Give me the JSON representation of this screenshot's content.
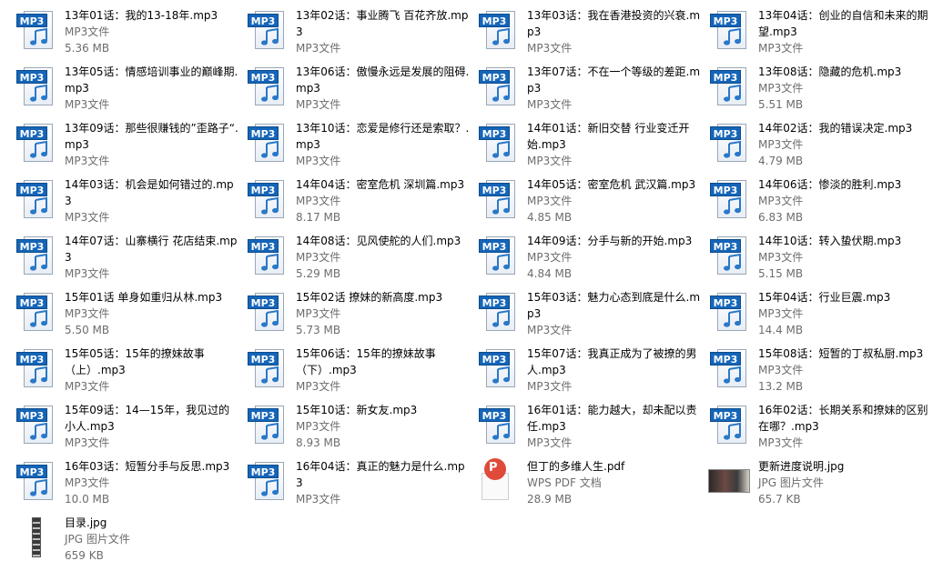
{
  "files": [
    {
      "name": "13年01话：我的13-18年.mp3",
      "type": "MP3文件",
      "size": "5.36 MB",
      "icon": "mp3-file-icon"
    },
    {
      "name": "13年02话：事业腾飞 百花齐放.mp3",
      "type": "MP3文件",
      "size": "",
      "icon": "mp3-file-icon"
    },
    {
      "name": "13年03话：我在香港投资的兴衰.mp3",
      "type": "MP3文件",
      "size": "",
      "icon": "mp3-file-icon"
    },
    {
      "name": "13年04话：创业的自信和未来的期望.mp3",
      "type": "MP3文件",
      "size": "",
      "icon": "mp3-file-icon"
    },
    {
      "name": "13年05话：情感培训事业的巅峰期.mp3",
      "type": "MP3文件",
      "size": "",
      "icon": "mp3-file-icon"
    },
    {
      "name": "13年06话：傲慢永远是发展的阻碍.mp3",
      "type": "MP3文件",
      "size": "",
      "icon": "mp3-file-icon"
    },
    {
      "name": "13年07话：不在一个等级的差距.mp3",
      "type": "MP3文件",
      "size": "",
      "icon": "mp3-file-icon"
    },
    {
      "name": "13年08话：隐藏的危机.mp3",
      "type": "MP3文件",
      "size": "5.51 MB",
      "icon": "mp3-file-icon"
    },
    {
      "name": "13年09话：那些很赚钱的”歪路子“.mp3",
      "type": "MP3文件",
      "size": "",
      "icon": "mp3-file-icon"
    },
    {
      "name": "13年10话：恋爱是修行还是索取？.mp3",
      "type": "MP3文件",
      "size": "",
      "icon": "mp3-file-icon"
    },
    {
      "name": "14年01话：新旧交替 行业变迁开始.mp3",
      "type": "MP3文件",
      "size": "",
      "icon": "mp3-file-icon"
    },
    {
      "name": "14年02话：我的错误决定.mp3",
      "type": "MP3文件",
      "size": "4.79 MB",
      "icon": "mp3-file-icon"
    },
    {
      "name": "14年03话：机会是如何错过的.mp3",
      "type": "MP3文件",
      "size": "",
      "icon": "mp3-file-icon"
    },
    {
      "name": "14年04话：密室危机 深圳篇.mp3",
      "type": "MP3文件",
      "size": "8.17 MB",
      "icon": "mp3-file-icon"
    },
    {
      "name": "14年05话：密室危机 武汉篇.mp3",
      "type": "MP3文件",
      "size": "4.85 MB",
      "icon": "mp3-file-icon"
    },
    {
      "name": "14年06话：惨淡的胜利.mp3",
      "type": "MP3文件",
      "size": "6.83 MB",
      "icon": "mp3-file-icon"
    },
    {
      "name": "14年07话：山寨横行 花店结束.mp3",
      "type": "MP3文件",
      "size": "",
      "icon": "mp3-file-icon"
    },
    {
      "name": "14年08话：见风使舵的人们.mp3",
      "type": "MP3文件",
      "size": "5.29 MB",
      "icon": "mp3-file-icon"
    },
    {
      "name": "14年09话：分手与新的开始.mp3",
      "type": "MP3文件",
      "size": "4.84 MB",
      "icon": "mp3-file-icon"
    },
    {
      "name": "14年10话：转入蛰伏期.mp3",
      "type": "MP3文件",
      "size": "5.15 MB",
      "icon": "mp3-file-icon"
    },
    {
      "name": "15年01话 单身如重归从林.mp3",
      "type": "MP3文件",
      "size": "5.50 MB",
      "icon": "mp3-file-icon"
    },
    {
      "name": "15年02话 撩妹的新高度.mp3",
      "type": "MP3文件",
      "size": "5.73 MB",
      "icon": "mp3-file-icon"
    },
    {
      "name": "15年03话：魅力心态到底是什么.mp3",
      "type": "MP3文件",
      "size": "",
      "icon": "mp3-file-icon"
    },
    {
      "name": "15年04话：行业巨震.mp3",
      "type": "MP3文件",
      "size": "14.4 MB",
      "icon": "mp3-file-icon"
    },
    {
      "name": "15年05话：15年的撩妹故事（上）.mp3",
      "type": "MP3文件",
      "size": "",
      "icon": "mp3-file-icon"
    },
    {
      "name": "15年06话：15年的撩妹故事（下）.mp3",
      "type": "MP3文件",
      "size": "",
      "icon": "mp3-file-icon"
    },
    {
      "name": "15年07话：我真正成为了被撩的男人.mp3",
      "type": "MP3文件",
      "size": "",
      "icon": "mp3-file-icon"
    },
    {
      "name": "15年08话：短暂的丁叔私厨.mp3",
      "type": "MP3文件",
      "size": "13.2 MB",
      "icon": "mp3-file-icon"
    },
    {
      "name": "15年09话：14—15年，我见过的小人.mp3",
      "type": "MP3文件",
      "size": "",
      "icon": "mp3-file-icon"
    },
    {
      "name": "15年10话：新女友.mp3",
      "type": "MP3文件",
      "size": "8.93 MB",
      "icon": "mp3-file-icon"
    },
    {
      "name": "16年01话：能力越大，却未配以责任.mp3",
      "type": "MP3文件",
      "size": "",
      "icon": "mp3-file-icon"
    },
    {
      "name": "16年02话：长期关系和撩妹的区别在哪？.mp3",
      "type": "MP3文件",
      "size": "",
      "icon": "mp3-file-icon"
    },
    {
      "name": "16年03话：短暂分手与反思.mp3",
      "type": "MP3文件",
      "size": "10.0 MB",
      "icon": "mp3-file-icon"
    },
    {
      "name": "16年04话：真正的魅力是什么.mp3",
      "type": "MP3文件",
      "size": "",
      "icon": "mp3-file-icon"
    },
    {
      "name": "但丁的多维人生.pdf",
      "type": "WPS PDF 文档",
      "size": "28.9 MB",
      "icon": "wps-pdf-icon"
    },
    {
      "name": "更新进度说明.jpg",
      "type": "JPG 图片文件",
      "size": "65.7 KB",
      "icon": "image-thumbnail-icon"
    },
    {
      "name": "目录.jpg",
      "type": "JPG 图片文件",
      "size": "659 KB",
      "icon": "image-thumbnail-icon"
    }
  ]
}
